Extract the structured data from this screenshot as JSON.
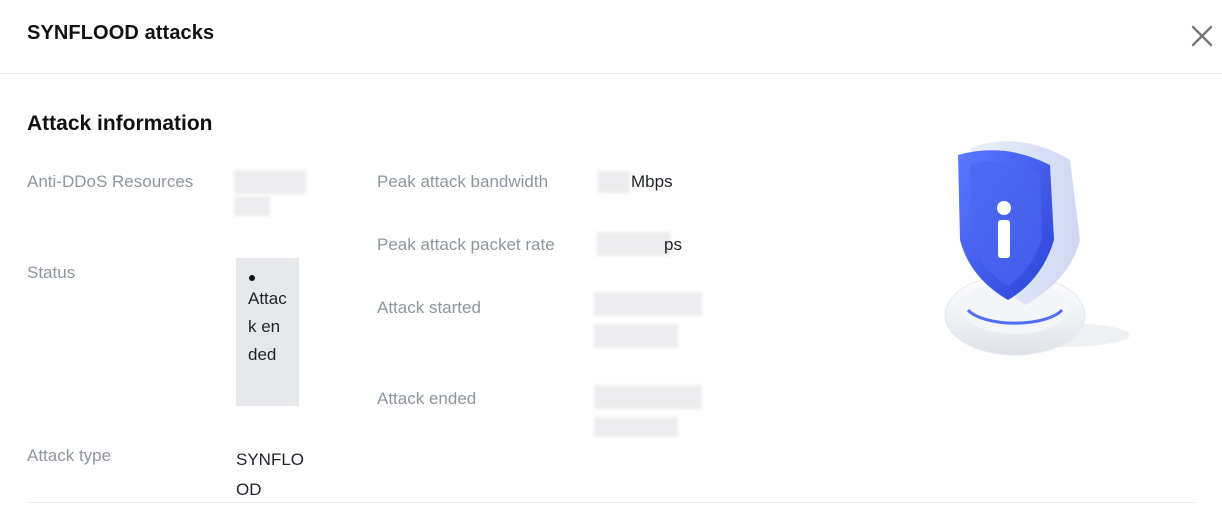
{
  "dialog": {
    "title": "SYNFLOOD attacks",
    "close_icon": "close-icon"
  },
  "section": {
    "title": "Attack information"
  },
  "fields": {
    "resources_label": "Anti-DDoS Resources",
    "status_label": "Status",
    "status_value": "Attack ended",
    "type_label": "Attack type",
    "type_value": "SYNFLOOD",
    "bandwidth_label": "Peak attack bandwidth",
    "bandwidth_unit": "Mbps",
    "packet_rate_label": "Peak attack packet rate",
    "packet_rate_unit_partial": "ps",
    "started_label": "Attack started",
    "ended_label": "Attack ended"
  },
  "illustration": {
    "icon": "shield-info-icon"
  },
  "colors": {
    "label": "#8f959e",
    "text": "#1f2329",
    "accent": "#3d5bf0",
    "status_bg": "#e6e8ec"
  }
}
